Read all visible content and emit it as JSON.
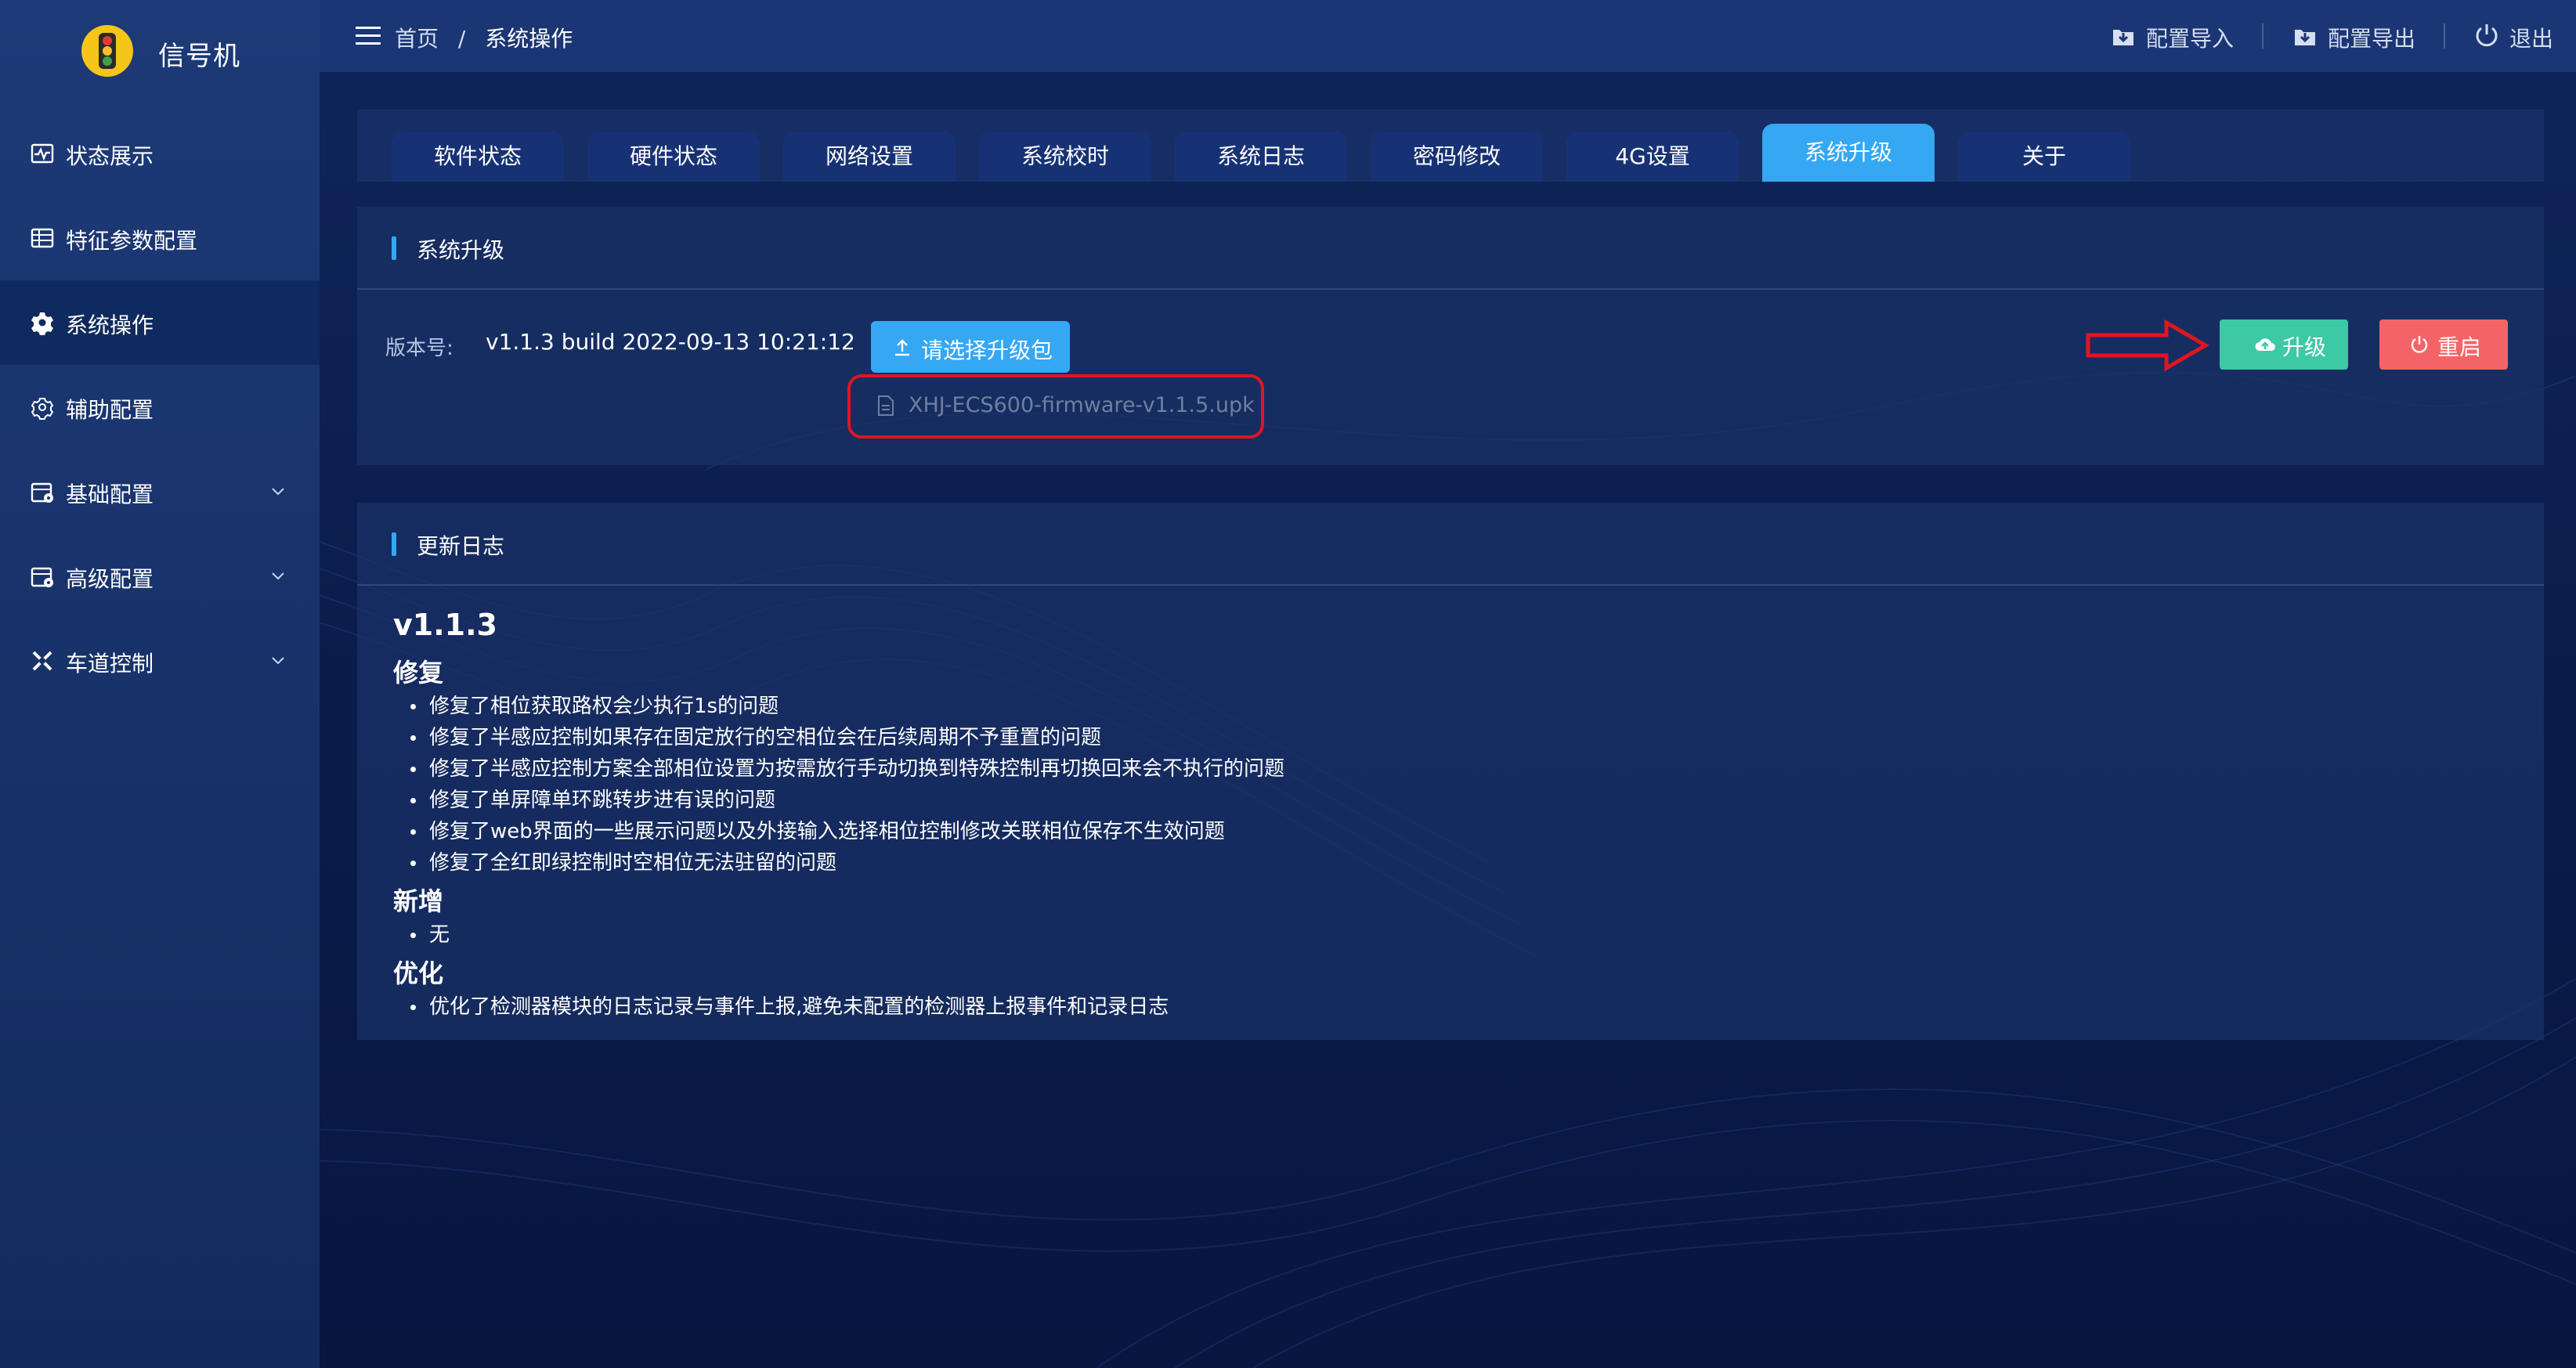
{
  "brand": {
    "title": "信号机"
  },
  "sidebar": {
    "items": [
      {
        "label": "状态展示",
        "icon": "pulse-chart-icon",
        "active": false,
        "expandable": false
      },
      {
        "label": "特征参数配置",
        "icon": "table-grid-icon",
        "active": false,
        "expandable": false
      },
      {
        "label": "系统操作",
        "icon": "gear-icon",
        "active": true,
        "expandable": false
      },
      {
        "label": "辅助配置",
        "icon": "cog-outline-icon",
        "active": false,
        "expandable": false
      },
      {
        "label": "基础配置",
        "icon": "calendar-settings-icon",
        "active": false,
        "expandable": true
      },
      {
        "label": "高级配置",
        "icon": "calendar-settings-icon",
        "active": false,
        "expandable": true
      },
      {
        "label": "车道控制",
        "icon": "crossroad-icon",
        "active": false,
        "expandable": true
      }
    ]
  },
  "header": {
    "breadcrumb": {
      "home": "首页",
      "separator": "/",
      "current": "系统操作"
    },
    "actions": [
      {
        "label": "配置导入",
        "icon": "import-icon"
      },
      {
        "label": "配置导出",
        "icon": "export-icon"
      },
      {
        "label": "退出",
        "icon": "power-icon"
      }
    ]
  },
  "tabs": [
    {
      "label": "软件状态",
      "active": false
    },
    {
      "label": "硬件状态",
      "active": false
    },
    {
      "label": "网络设置",
      "active": false
    },
    {
      "label": "系统校时",
      "active": false
    },
    {
      "label": "系统日志",
      "active": false
    },
    {
      "label": "密码修改",
      "active": false
    },
    {
      "label": "4G设置",
      "active": false
    },
    {
      "label": "系统升级",
      "active": true
    },
    {
      "label": "关于",
      "active": false
    }
  ],
  "upgrade": {
    "title": "系统升级",
    "version_label": "版本号:",
    "version_value": "v1.1.3 build 2022-09-13 10:21:12",
    "select_button": "请选择升级包",
    "selected_file": "XHJ-ECS600-firmware-v1.1.5.upk",
    "upgrade_button": "升级",
    "restart_button": "重启"
  },
  "changelog": {
    "title": "更新日志",
    "version": "v1.1.3",
    "sections": [
      {
        "heading": "修复",
        "items": [
          "修复了相位获取路权会少执行1s的问题",
          "修复了半感应控制如果存在固定放行的空相位会在后续周期不予重置的问题",
          "修复了半感应控制方案全部相位设置为按需放行手动切换到特殊控制再切换回来会不执行的问题",
          "修复了单屏障单环跳转步进有误的问题",
          "修复了web界面的一些展示问题以及外接输入选择相位控制修改关联相位保存不生效问题",
          "修复了全红即绿控制时空相位无法驻留的问题"
        ]
      },
      {
        "heading": "新增",
        "items": [
          "无"
        ]
      },
      {
        "heading": "优化",
        "items": [
          "优化了检测器模块的日志记录与事件上报,避免未配置的检测器上报事件和记录日志"
        ]
      }
    ]
  },
  "colors": {
    "accent_blue": "#35a7f3",
    "upgrade_green": "#3cc9a6",
    "restart_red": "#f46467",
    "annotation_red": "#e0151f"
  }
}
